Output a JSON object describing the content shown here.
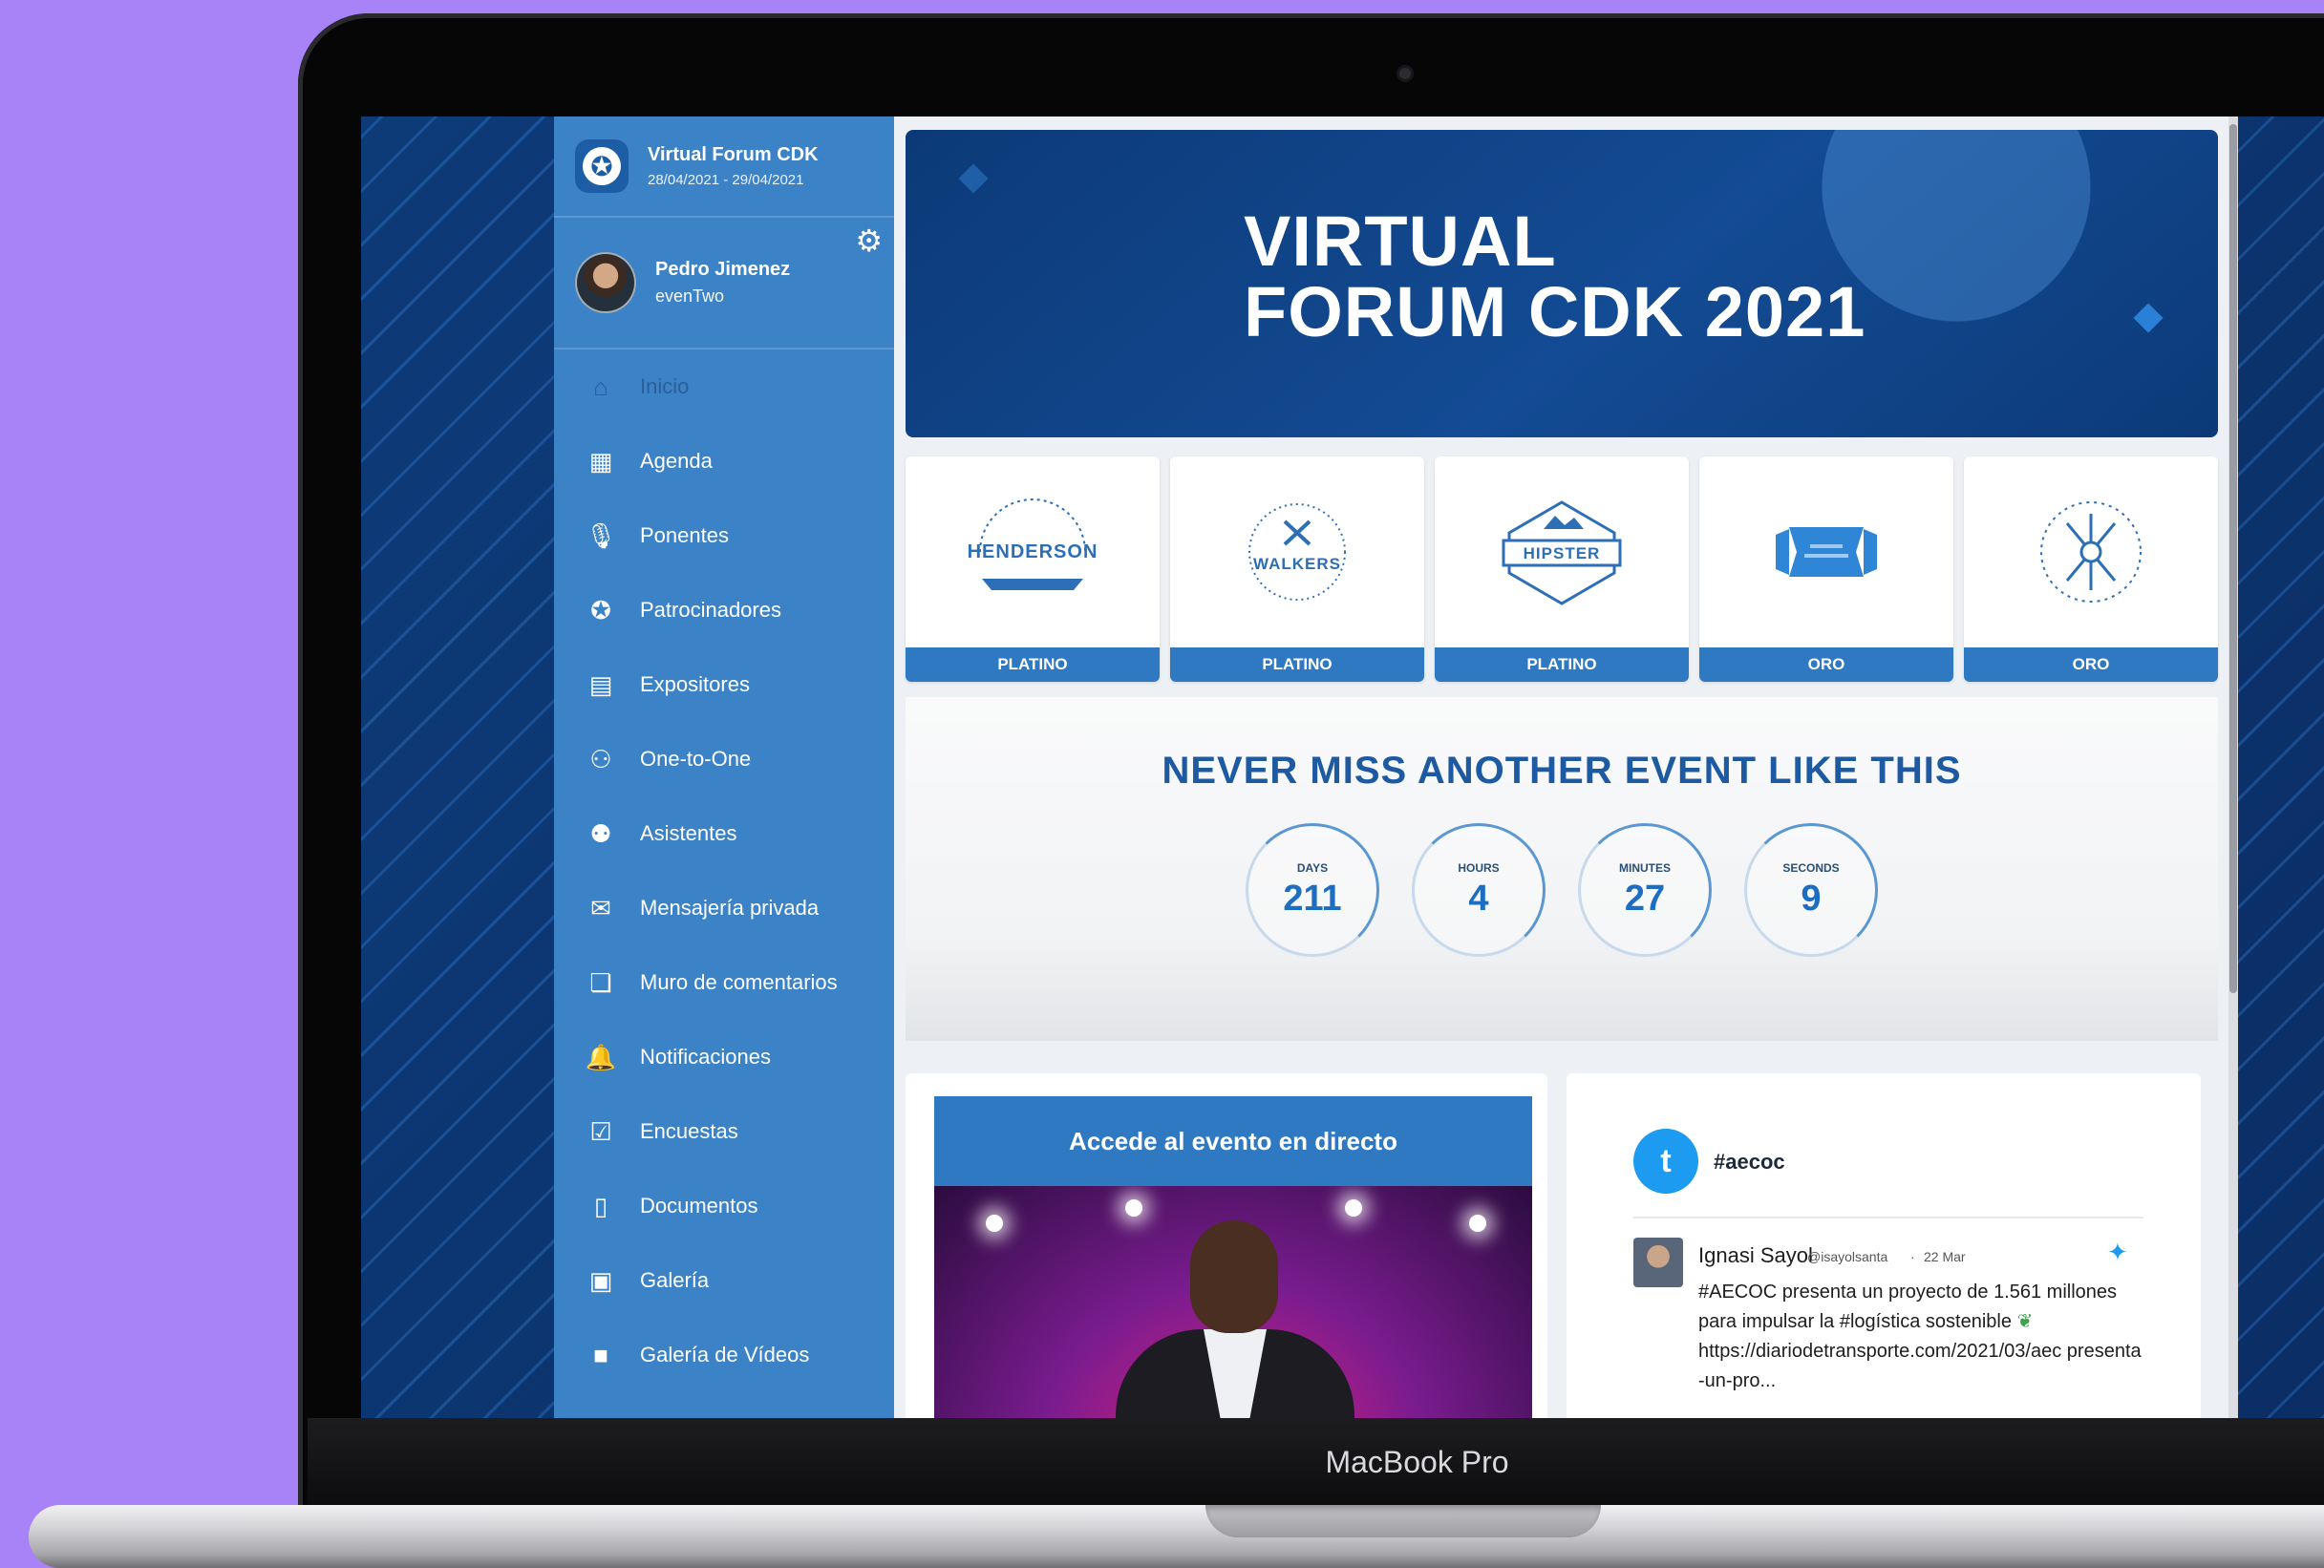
{
  "device": {
    "label": "MacBook Pro"
  },
  "event": {
    "title": "Virtual Forum CDK",
    "dates": "28/04/2021 - 29/04/2021",
    "logo_icon": "star-badge-icon"
  },
  "user": {
    "name": "Pedro Jimenez",
    "organization": "evenTwo",
    "settings_icon": "gear-icon"
  },
  "sidebar": {
    "items": [
      {
        "label": "Inicio",
        "icon": "home-icon",
        "glyph": "⌂",
        "active": true
      },
      {
        "label": "Agenda",
        "icon": "calendar-icon",
        "glyph": "▦"
      },
      {
        "label": "Ponentes",
        "icon": "microphone-icon",
        "glyph": "🎙"
      },
      {
        "label": "Patrocinadores",
        "icon": "star-icon",
        "glyph": "✪"
      },
      {
        "label": "Expositores",
        "icon": "booth-icon",
        "glyph": "▤"
      },
      {
        "label": "One-to-One",
        "icon": "meeting-icon",
        "glyph": "⚇"
      },
      {
        "label": "Asistentes",
        "icon": "attendees-icon",
        "glyph": "⚉"
      },
      {
        "label": "Mensajería privada",
        "icon": "envelope-icon",
        "glyph": "✉"
      },
      {
        "label": "Muro de comentarios",
        "icon": "comments-icon",
        "glyph": "❏"
      },
      {
        "label": "Notificaciones",
        "icon": "bell-icon",
        "glyph": "🔔"
      },
      {
        "label": "Encuestas",
        "icon": "survey-icon",
        "glyph": "☑"
      },
      {
        "label": "Documentos",
        "icon": "document-icon",
        "glyph": "▯"
      },
      {
        "label": "Galería",
        "icon": "image-icon",
        "glyph": "▣"
      },
      {
        "label": "Galería de Vídeos",
        "icon": "video-icon",
        "glyph": "■"
      }
    ]
  },
  "banner": {
    "line1": "VIRTUAL",
    "line2": "FORUM CDK 2021"
  },
  "sponsors": [
    {
      "name": "HENDERSON",
      "level": "PLATINO"
    },
    {
      "name": "WALKERS",
      "level": "PLATINO"
    },
    {
      "name": "HIPSTER",
      "level": "PLATINO"
    },
    {
      "name": "",
      "level": "ORO"
    },
    {
      "name": "",
      "level": "ORO"
    }
  ],
  "countdown": {
    "title": "NEVER MISS ANOTHER EVENT LIKE THIS",
    "units": [
      {
        "label": "DAYS",
        "value": "211"
      },
      {
        "label": "HOURS",
        "value": "4"
      },
      {
        "label": "MINUTES",
        "value": "27"
      },
      {
        "label": "SECONDS",
        "value": "9"
      }
    ]
  },
  "live": {
    "title": "Accede al evento en directo"
  },
  "twitter": {
    "hashtag": "#aecoc",
    "tweet": {
      "author": "Ignasi Sayol",
      "handle": "@isayolsanta",
      "separator": "·",
      "date": "22 Mar",
      "text": "#AECOC presenta un proyecto de 1.561 millones para impulsar la #logística sostenible",
      "link": "https://diariodetransporte.com/2021/03/aec presenta-un-pro..."
    }
  },
  "colors": {
    "sidebar": "#3c82c7",
    "accent": "#2f79c3",
    "banner": "#0c3a78",
    "background": "#a883f7",
    "twitter": "#1d9bf0"
  }
}
